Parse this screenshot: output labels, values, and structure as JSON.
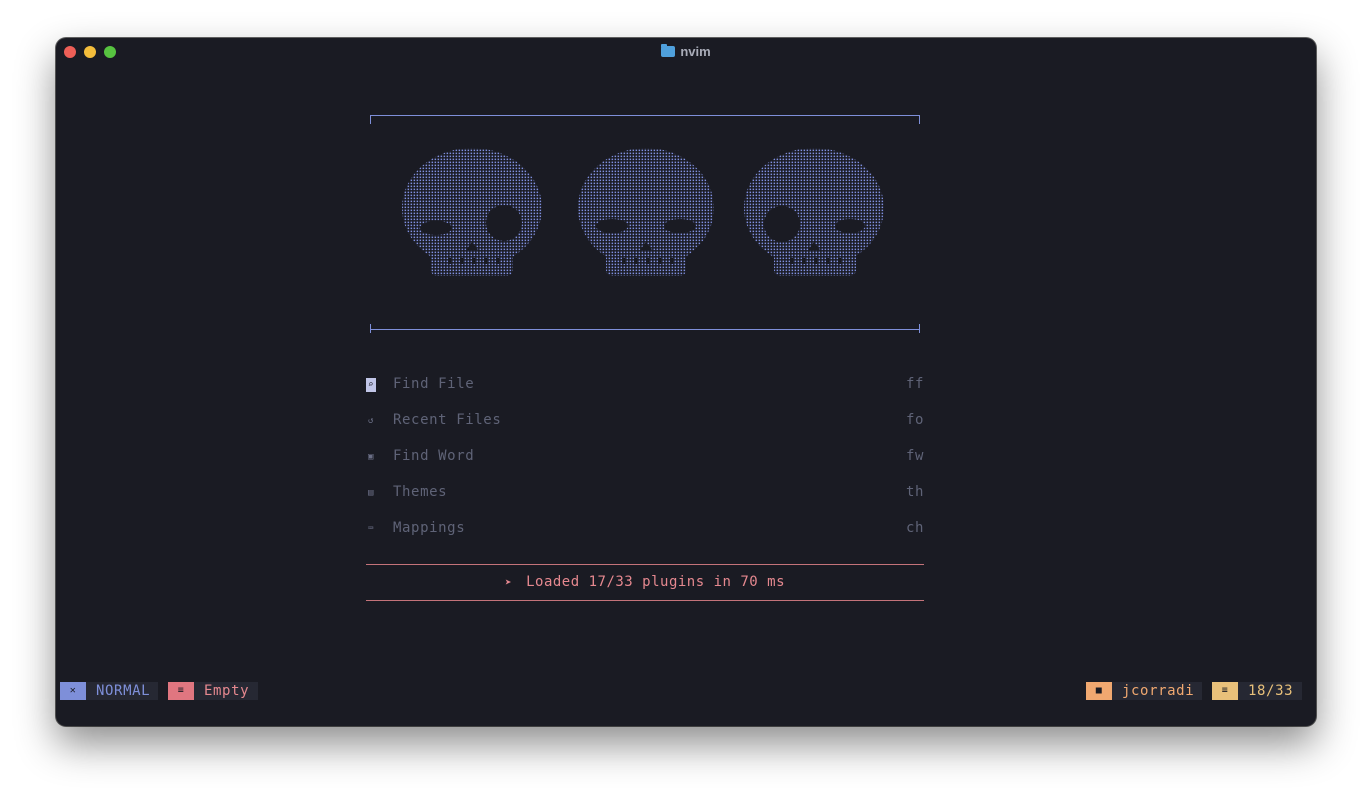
{
  "window": {
    "title": "nvim",
    "title_icon": "folder-icon",
    "controls": [
      "close",
      "minimize",
      "zoom"
    ]
  },
  "dashboard": {
    "header_art": "three-ascii-skulls",
    "menu": [
      {
        "icon": "search-icon",
        "label": "Find File",
        "key": "ff",
        "active": true
      },
      {
        "icon": "history-icon",
        "label": "Recent Files",
        "key": "fo"
      },
      {
        "icon": "word-icon",
        "label": "Find Word",
        "key": "fw"
      },
      {
        "icon": "palette-icon",
        "label": "Themes",
        "key": "th"
      },
      {
        "icon": "keyboard-icon",
        "label": "Mappings",
        "key": "ch"
      }
    ],
    "footer": {
      "icon": "rocket-icon",
      "text": "Loaded 17/33 plugins in 70 ms"
    }
  },
  "statusline": {
    "mode": {
      "icon": "vim-icon",
      "label": "NORMAL"
    },
    "file": {
      "icon": "file-icon",
      "label": "Empty"
    },
    "cwd": {
      "icon": "folder-icon",
      "label": "jcorradi"
    },
    "position": {
      "icon": "lines-icon",
      "label": "18/33"
    }
  },
  "colors": {
    "background": "#1a1b23",
    "accent_blue": "#7e8fd9",
    "accent_red": "#e5888f",
    "accent_orange": "#f0a870",
    "accent_yellow": "#e8c07a",
    "menu_text": "#5f6377"
  }
}
